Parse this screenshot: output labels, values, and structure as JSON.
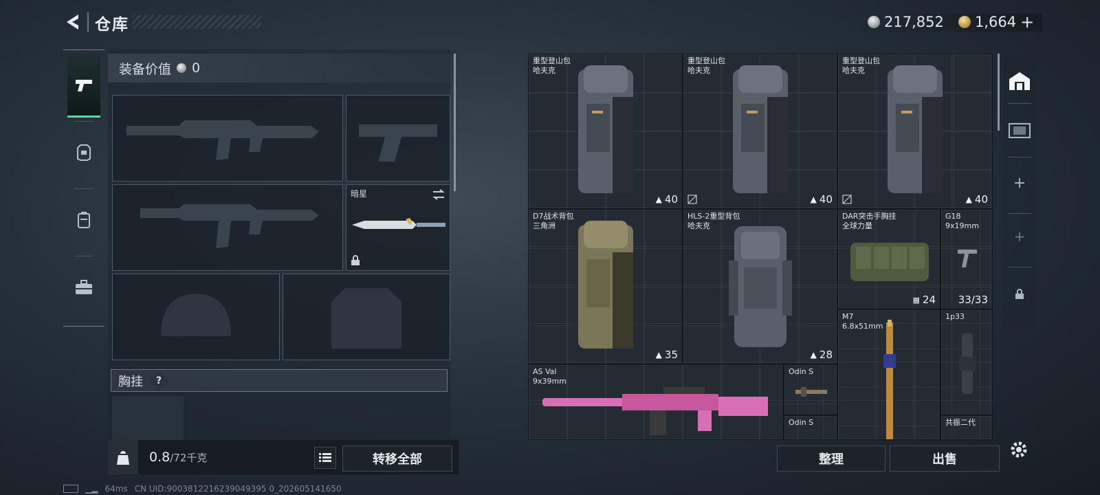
{
  "header": {
    "title": "仓库",
    "currency_silver": "217,852",
    "currency_gold": "1,664"
  },
  "left_panel": {
    "equip_value_label": "装备价值",
    "equip_value": "0",
    "melee_slot_label": "暗星",
    "section_label": "胸挂",
    "section_help": "?",
    "weight_current": "0.8",
    "weight_max": "/72千克",
    "transfer_all": "转移全部"
  },
  "grid": {
    "items": [
      {
        "name": "重型登山包",
        "sub": "哈夫克",
        "count": "40",
        "color": "red"
      },
      {
        "name": "重型登山包",
        "sub": "哈夫克",
        "count": "40",
        "color": "red"
      },
      {
        "name": "重型登山包",
        "sub": "哈夫克",
        "count": "40",
        "color": "red"
      },
      {
        "name": "D7战术背包",
        "sub": "三角洲",
        "count": "35",
        "color": "red"
      },
      {
        "name": "HLS-2重型背包",
        "sub": "哈夫克",
        "count": "28",
        "color": "brown"
      },
      {
        "name": "DAR突击手胸挂",
        "sub": "全球力量",
        "count": "24",
        "color": "brown"
      },
      {
        "name": "G18",
        "sub": "9x19mm",
        "count": "33/33",
        "color": "dark"
      },
      {
        "name": "M7",
        "sub": "6.8x51mm",
        "count": "",
        "color": "dark"
      },
      {
        "name": "1p33",
        "sub": "",
        "count": "",
        "color": "dark"
      },
      {
        "name": "AS Val",
        "sub": "9x39mm",
        "count": "",
        "color": "dark"
      },
      {
        "name": "Odin S",
        "sub": "",
        "count": "",
        "color": "dark"
      },
      {
        "name": "Odin S",
        "sub": "",
        "count": "",
        "color": "dark"
      },
      {
        "name": "共振二代",
        "sub": "",
        "count": "",
        "color": "dark"
      }
    ]
  },
  "buttons": {
    "sort": "整理",
    "sell": "出售"
  },
  "status": {
    "ping": "64ms",
    "uid": "CN UID:9003812216239049395 0_202605141650"
  }
}
